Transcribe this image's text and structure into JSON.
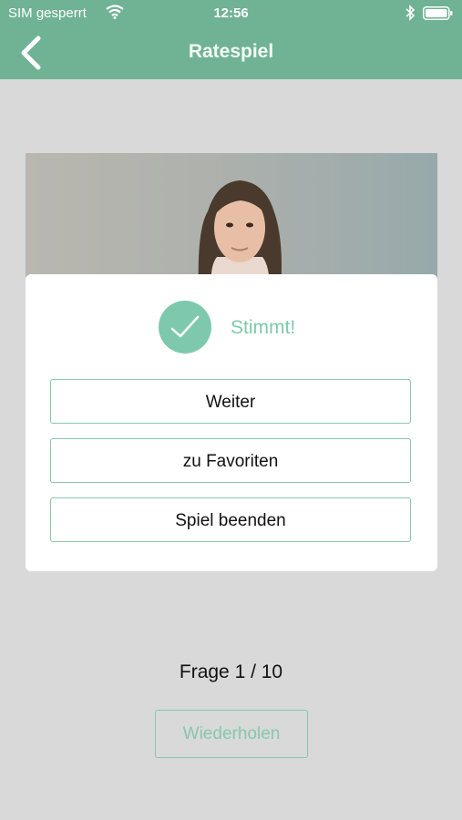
{
  "status_bar": {
    "carrier": "SIM gesperrt",
    "time": "12:56"
  },
  "header": {
    "title": "Ratespiel",
    "back_icon": "chevron-left-icon"
  },
  "result_dialog": {
    "result_label": "Stimmt!",
    "result_icon": "checkmark-icon",
    "buttons": {
      "next": "Weiter",
      "favorites": "zu Favoriten",
      "end": "Spiel beenden"
    }
  },
  "question": {
    "progress_label": "Frage 1 / 10",
    "current": 1,
    "total": 10
  },
  "repeat_button": "Wiederholen",
  "colors": {
    "accent": "#6fb394",
    "success": "#7ec9ad",
    "background": "#d9d9d9"
  }
}
